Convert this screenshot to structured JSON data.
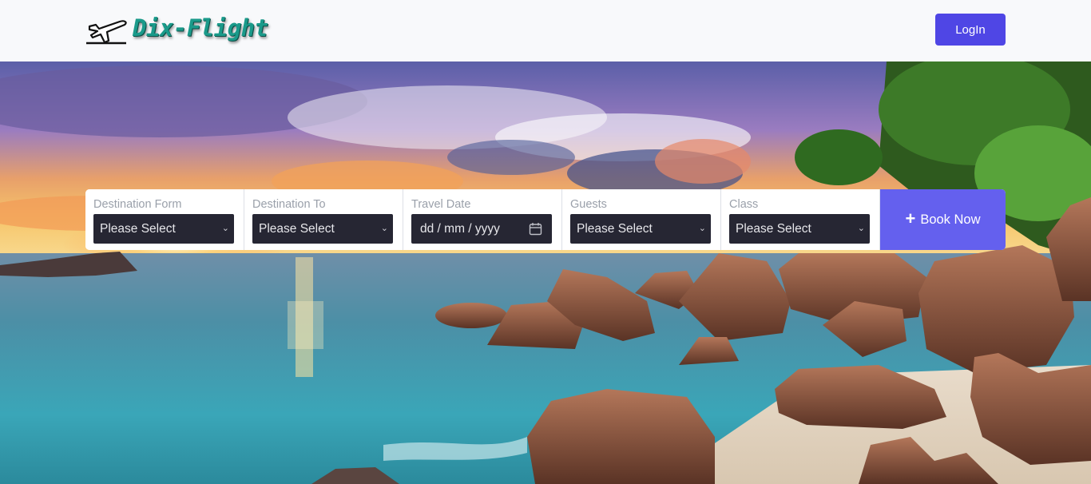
{
  "brand": {
    "name": "Dix-Flight",
    "icon": "airplane-icon"
  },
  "nav": {
    "login_label": "LogIn"
  },
  "booking": {
    "fields": [
      {
        "label": "Destination Form",
        "value": "Please Select",
        "type": "select"
      },
      {
        "label": "Destination To",
        "value": "Please Select",
        "type": "select"
      },
      {
        "label": "Travel Date",
        "value": "dd / mm / yyyy",
        "type": "date"
      },
      {
        "label": "Guests",
        "value": "Please Select",
        "type": "select"
      },
      {
        "label": "Class",
        "value": "Please Select",
        "type": "select"
      }
    ],
    "book_label": "Book Now",
    "book_icon": "plus-icon"
  },
  "colors": {
    "primary": "#4f46e5",
    "book": "#6460ee",
    "brand_text": "#1a9a8a",
    "control_bg": "#262633"
  }
}
